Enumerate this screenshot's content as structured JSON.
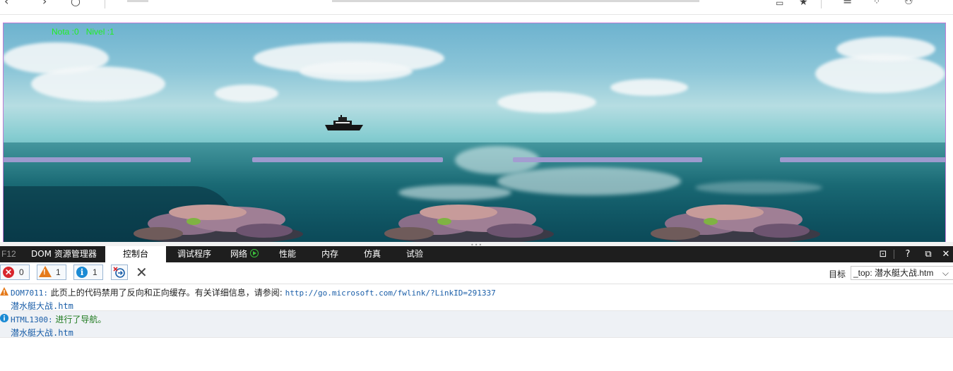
{
  "game": {
    "hud": "Nota :0   Nivel :1"
  },
  "devtools": {
    "f12": "F12",
    "tabs": [
      {
        "label": "DOM 资源管理器"
      },
      {
        "label": "控制台"
      },
      {
        "label": "调试程序"
      },
      {
        "label": "网络"
      },
      {
        "label": "性能"
      },
      {
        "label": "内存"
      },
      {
        "label": "仿真"
      },
      {
        "label": "试验"
      }
    ],
    "right_controls": {
      "console": "⊡",
      "help": "?",
      "undock": "⧉",
      "close": "✕"
    }
  },
  "console": {
    "filters": {
      "errors": "0",
      "warnings": "1",
      "messages": "1"
    },
    "target_label": "目标",
    "target_value": "_top: 潜水艇大战.htm",
    "messages": [
      {
        "type": "warning",
        "code": "DOM7011:",
        "text": " 此页上的代码禁用了反向和正向缓存。有关详细信息，请参阅: ",
        "link": "http://go.microsoft.com/fwlink/?LinkID=291337",
        "source": "潜水艇大战.htm"
      },
      {
        "type": "info",
        "code": "HTML1300:",
        "text": " 进行了导航。",
        "source": "潜水艇大战.htm"
      }
    ]
  },
  "colors": {
    "hud_green": "#22ee22",
    "devtools_bar": "#1e1e1e",
    "warning_orange": "#e57a1a",
    "info_blue": "#1a8ad4",
    "error_red": "#d8262d",
    "platform": "#a39bd2"
  }
}
